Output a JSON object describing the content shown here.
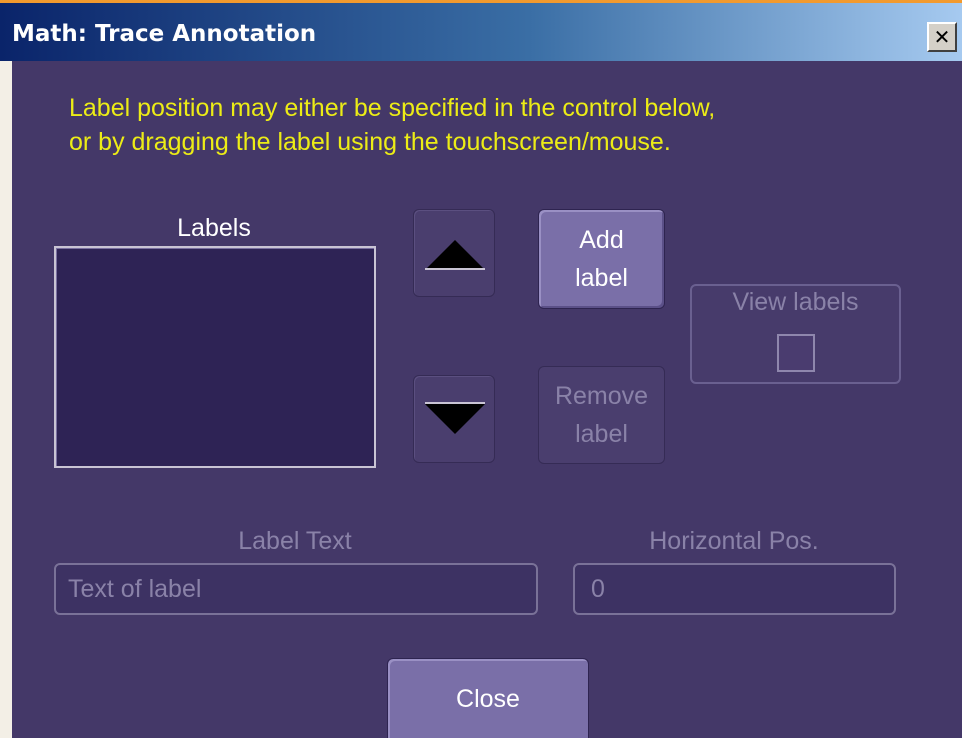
{
  "window": {
    "title": "Math: Trace Annotation",
    "close_glyph": "✕"
  },
  "instructions": {
    "line1": "Label position may either be specified in the control below,",
    "line2": "or by dragging the label using the touchscreen/mouse."
  },
  "labels_list": {
    "title": "Labels",
    "items": []
  },
  "buttons": {
    "move_up_icon": "triangle-up-icon",
    "move_down_icon": "triangle-down-icon",
    "add_line1": "Add",
    "add_line2": "label",
    "remove_line1": "Remove",
    "remove_line2": "label",
    "close": "Close"
  },
  "view_labels": {
    "label": "View labels",
    "checked": false
  },
  "fields": {
    "label_text_title": "Label Text",
    "label_text_value": "Text of label",
    "hpos_title": "Horizontal Pos.",
    "hpos_value": "0"
  },
  "colors": {
    "dialog_bg": "#443868",
    "instruction_text": "#ecec16",
    "disabled_text": "#8a82a8",
    "titlebar_start": "#0a246a",
    "titlebar_end": "#a6caf0"
  }
}
